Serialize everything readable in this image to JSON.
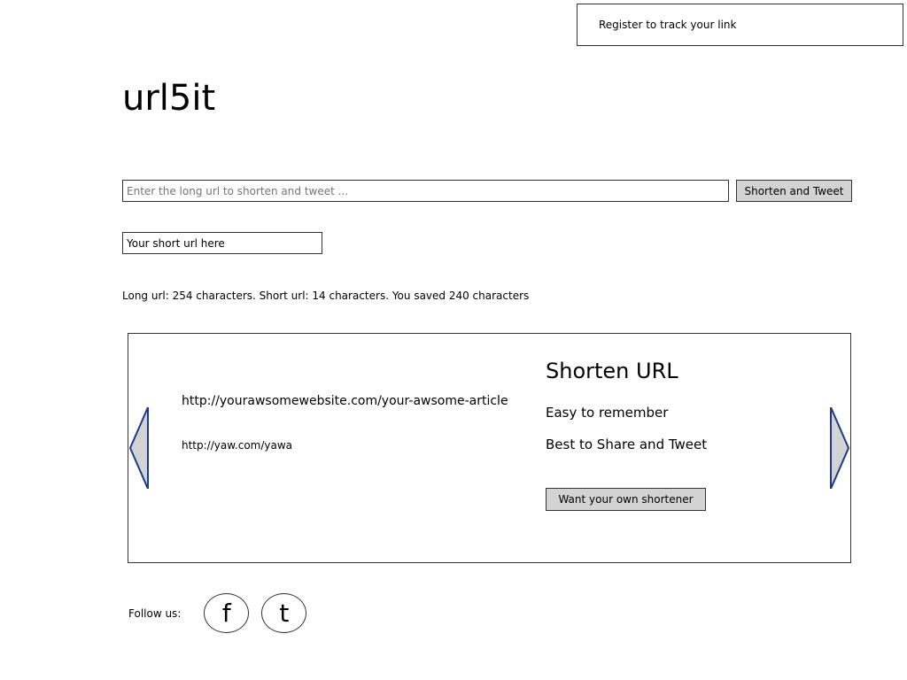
{
  "header": {
    "register_text": "Register to track your link"
  },
  "logo": {
    "text": "url5it"
  },
  "url_input": {
    "placeholder": "Enter the long url to shorten and tweet ...",
    "button_label": "Shorten and Tweet"
  },
  "short_url": {
    "text": "Your short url here"
  },
  "stats": {
    "text": "Long url: 254 characters. Short url: 14 characters. You saved 240 characters"
  },
  "carousel": {
    "long_url": "http://yourawsomewebsite.com/your-awsome-article",
    "short_url": "http://yaw.com/yawa",
    "title": "Shorten URL",
    "feature_1": "Easy to remember",
    "feature_2": "Best to Share and Tweet",
    "cta_button": "Want your own shortener"
  },
  "footer": {
    "follow_label": "Follow us:",
    "facebook_glyph": "f",
    "twitter_glyph": "t"
  },
  "colors": {
    "arrow_color": "#1e3a8a",
    "button_bg": "#d3d3d3",
    "border": "#333333"
  }
}
